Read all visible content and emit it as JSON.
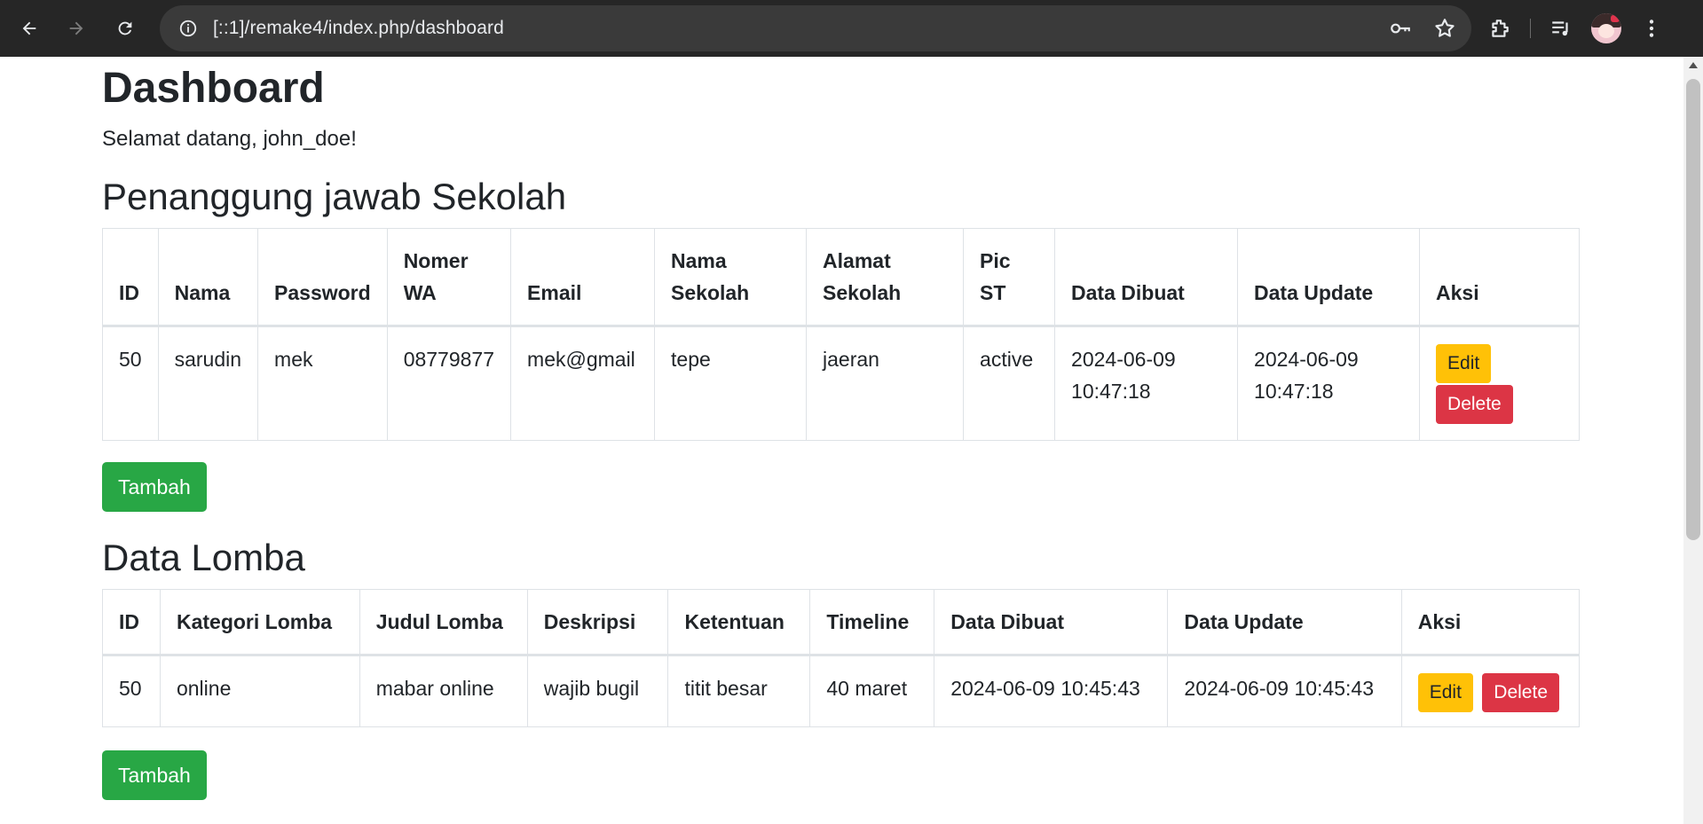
{
  "browser": {
    "url": "[::1]/remake4/index.php/dashboard"
  },
  "page": {
    "title": "Dashboard",
    "welcome": "Selamat datang, john_doe!"
  },
  "pj_section": {
    "title": "Penanggung jawab Sekolah",
    "headers": [
      "ID",
      "Nama",
      "Password",
      "Nomer WA",
      "Email",
      "Nama Sekolah",
      "Alamat Sekolah",
      "Pic ST",
      "Data Dibuat",
      "Data Update",
      "Aksi"
    ],
    "rows": [
      {
        "id": "50",
        "nama": "sarudin",
        "password": "mek",
        "nomer_wa": "08779877",
        "email": "mek@gmail",
        "nama_sekolah": "tepe",
        "alamat_sekolah": "jaeran",
        "pic_st": "active",
        "data_dibuat": "2024-06-09 10:47:18",
        "data_update": "2024-06-09 10:47:18"
      }
    ],
    "edit_label": "Edit",
    "delete_label": "Delete",
    "add_label": "Tambah"
  },
  "lomba_section": {
    "title": "Data Lomba",
    "headers": [
      "ID",
      "Kategori Lomba",
      "Judul Lomba",
      "Deskripsi",
      "Ketentuan",
      "Timeline",
      "Data Dibuat",
      "Data Update",
      "Aksi"
    ],
    "rows": [
      {
        "id": "50",
        "kategori": "online",
        "judul": "mabar online",
        "deskripsi": "wajib bugil",
        "ketentuan": "titit besar",
        "timeline": "40 maret",
        "data_dibuat": "2024-06-09 10:45:43",
        "data_update": "2024-06-09 10:45:43"
      }
    ],
    "edit_label": "Edit",
    "delete_label": "Delete",
    "add_label": "Tambah"
  },
  "icons": {
    "back": "arrow-left-icon",
    "forward": "arrow-right-icon",
    "reload": "reload-icon",
    "site_info": "info-icon",
    "password": "key-icon",
    "bookmark": "star-icon",
    "extensions": "puzzle-icon",
    "media": "media-control-icon",
    "menu": "kebab-menu-icon"
  },
  "colors": {
    "warning": "#ffc107",
    "danger": "#dc3545",
    "success": "#28a745",
    "chrome_bg": "#262626"
  }
}
